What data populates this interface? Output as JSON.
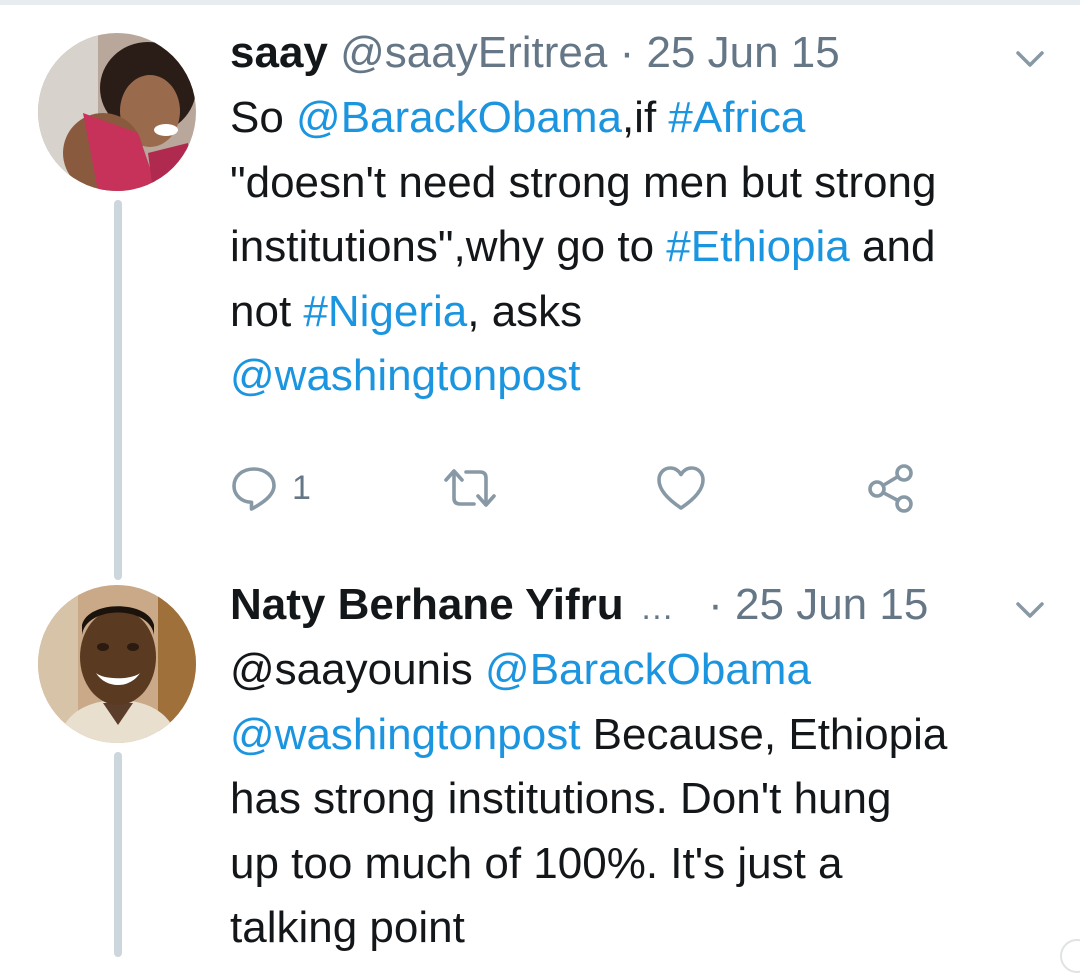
{
  "tweets": [
    {
      "name": "saay",
      "handle": "@saayEritrea",
      "separator": "·",
      "date": "25 Jun 15",
      "body_lines": [
        [
          {
            "t": "So ",
            "link": false
          },
          {
            "t": "@BarackObama",
            "link": true
          },
          {
            "t": ",if ",
            "link": false
          },
          {
            "t": "#Africa",
            "link": true
          }
        ],
        [
          {
            "t": "\"doesn't need strong men but strong",
            "link": false
          }
        ],
        [
          {
            "t": "institutions\",why go to ",
            "link": false
          },
          {
            "t": "#Ethiopia",
            "link": true
          },
          {
            "t": " and",
            "link": false
          }
        ],
        [
          {
            "t": "not  ",
            "link": false
          },
          {
            "t": "#Nigeria",
            "link": true
          },
          {
            "t": ", asks",
            "link": false
          }
        ],
        [
          {
            "t": "@washingtonpost",
            "link": true
          }
        ]
      ],
      "actions": {
        "reply_count": "1",
        "reply_icon": "reply-icon",
        "retweet_icon": "retweet-icon",
        "like_icon": "heart-icon",
        "share_icon": "share-icon"
      },
      "avatar_icon": "avatar-photo"
    },
    {
      "name": "Naty Berhane Yifru",
      "name_ellipsis": "…",
      "separator": "·",
      "date": "25 Jun 15",
      "body_lines": [
        [
          {
            "t": "@saayounis",
            "link": false
          },
          {
            "t": " ",
            "link": false
          },
          {
            "t": "@BarackObama",
            "link": true
          }
        ],
        [
          {
            "t": "@washingtonpost",
            "link": true
          },
          {
            "t": " Because, Ethiopia",
            "link": false
          }
        ],
        [
          {
            "t": "has strong institutions. Don't hung",
            "link": false
          }
        ],
        [
          {
            "t": "up too much of 100%. It's just a",
            "link": false
          }
        ],
        [
          {
            "t": "talking point",
            "link": false
          }
        ]
      ],
      "avatar_icon": "avatar-photo"
    }
  ],
  "colors": {
    "text": "#14171a",
    "secondary": "#657786",
    "link": "#1b95e0",
    "thread_line": "#ccd6dd"
  },
  "icons": {
    "chevron": "chevron-down-icon"
  }
}
